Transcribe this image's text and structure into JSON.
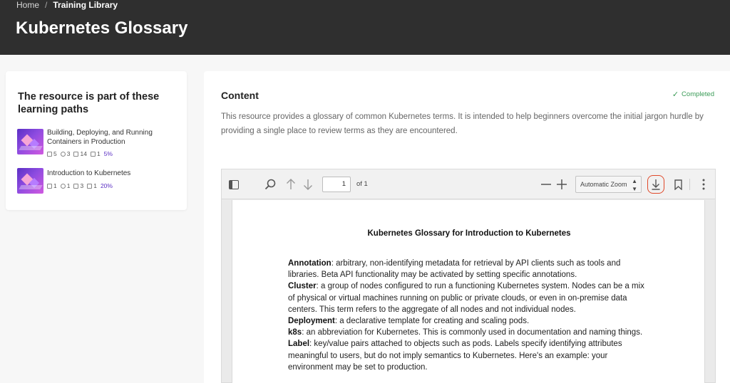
{
  "breadcrumb": {
    "home": "Home",
    "separator": "/",
    "current": "Training Library"
  },
  "page_title": "Kubernetes Glossary",
  "sidebar": {
    "heading": "The resource is part of these learning paths",
    "items": [
      {
        "title": "Building, Deploying, and Running Containers in Production",
        "stats": [
          "5",
          "3",
          "14",
          "1"
        ],
        "progress": "5%"
      },
      {
        "title": "Introduction to Kubernetes",
        "stats": [
          "1",
          "1",
          "3",
          "1"
        ],
        "progress": "20%"
      }
    ]
  },
  "content": {
    "heading": "Content",
    "status": "Completed",
    "description": "This resource provides a glossary of common Kubernetes terms. It is intended to help beginners overcome the initial jargon hurdle by providing a single place to review terms as they are encountered."
  },
  "pdf_viewer": {
    "page_number": "1",
    "page_of": "of 1",
    "zoom": "Automatic Zoom",
    "document_title": "Kubernetes Glossary for Introduction to Kubernetes",
    "entries": [
      {
        "term": "Annotation",
        "definition": ": arbitrary, non-identifying metadata for retrieval by API clients such as tools and libraries. Beta API functionality may be activated by setting specific annotations."
      },
      {
        "term": "Cluster",
        "definition": ": a group of nodes configured to run a functioning Kubernetes system. Nodes can be a mix of physical or virtual machines running on public or private clouds, or even in on-premise data centers. This term refers to the aggregate of all nodes and not individual nodes."
      },
      {
        "term": "Deployment",
        "definition": ": a declarative template for creating and scaling pods."
      },
      {
        "term": "k8s",
        "definition": ": an abbreviation for Kubernetes. This is commonly used in documentation and naming things."
      },
      {
        "term": "Label",
        "definition": ": key/value pairs attached to objects such as pods. Labels specify identifying attributes meaningful to users, but do not imply semantics to Kubernetes. Here's an example: your environment may be set to production."
      }
    ]
  },
  "colors": {
    "header_bg": "#2f2f2f",
    "accent": "#5b2fc4",
    "completed": "#3a9b57",
    "download_highlight": "#e0492a"
  }
}
